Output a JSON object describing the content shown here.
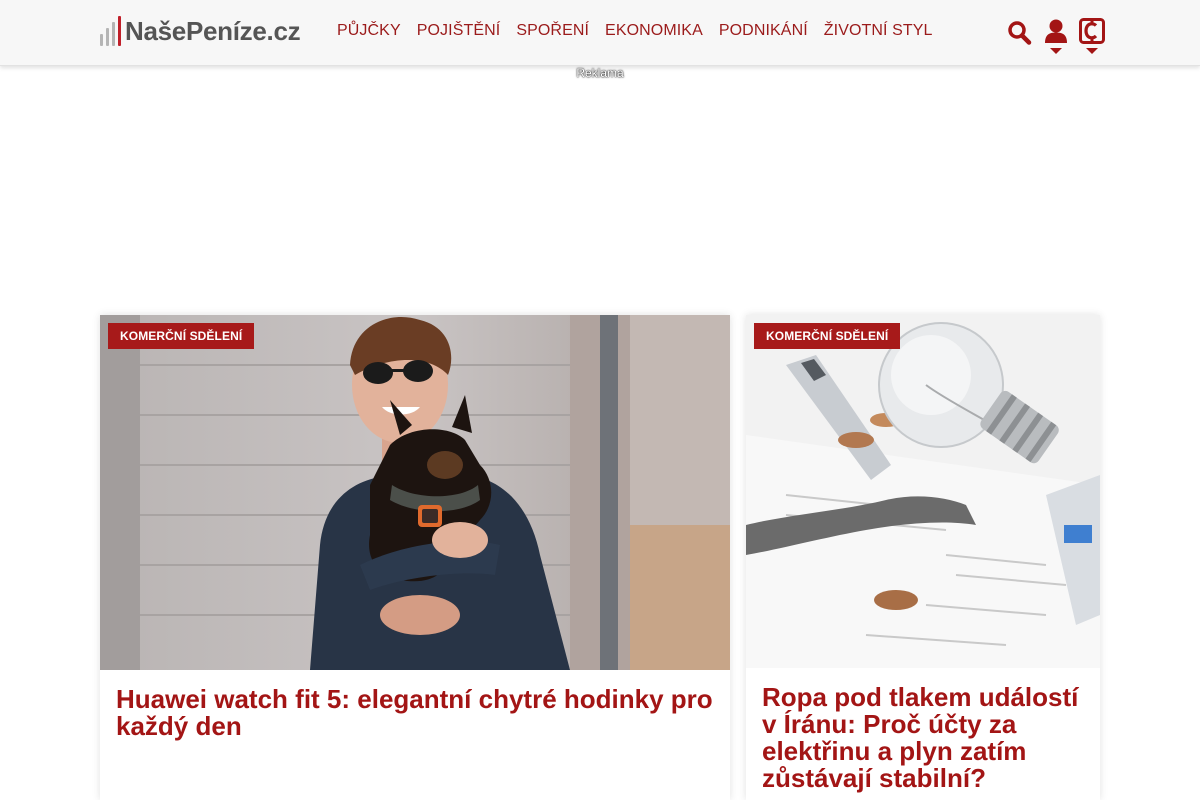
{
  "site": {
    "logo_text": "NašePeníze",
    "logo_domain": ".cz"
  },
  "nav": {
    "items": [
      {
        "label": "PŮJČKY"
      },
      {
        "label": "POJIŠTĚNÍ"
      },
      {
        "label": "SPOŘENÍ"
      },
      {
        "label": "EKONOMIKA"
      },
      {
        "label": "PODNIKÁNÍ"
      },
      {
        "label": "ŽIVOTNÍ STYL"
      }
    ]
  },
  "tools": {
    "search_icon": "search-icon",
    "user_icon": "user-icon",
    "brand_icon": "brand-c-icon"
  },
  "ad": {
    "label": "Reklama"
  },
  "articles": [
    {
      "badge": "KOMERČNÍ SDĚLENÍ",
      "title": "Huawei watch fit 5: elegantní chytré hodinky pro každý den"
    },
    {
      "badge": "KOMERČNÍ SDĚLENÍ",
      "title": "Ropa pod tlakem událostí v Íránu: Proč účty za elektřinu a plyn zatím zůstávají stabilní?"
    }
  ],
  "colors": {
    "accent": "#a31515",
    "badge_bg": "#a71a1a",
    "header_bg": "#f7f7f7"
  }
}
